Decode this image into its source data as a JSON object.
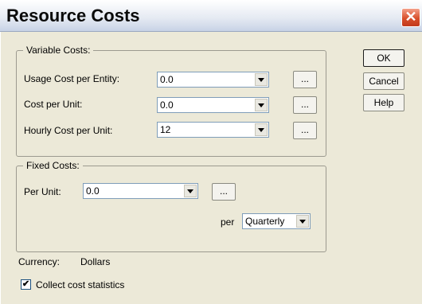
{
  "window": {
    "title": "Resource Costs",
    "close_glyph": "✕"
  },
  "variable_costs": {
    "legend": "Variable Costs:",
    "rows": [
      {
        "label": "Usage Cost per Entity:",
        "value": "0.0",
        "button": "..."
      },
      {
        "label": "Cost per Unit:",
        "value": "0.0",
        "button": "..."
      },
      {
        "label": "Hourly Cost per Unit:",
        "value": "12",
        "button": "..."
      }
    ]
  },
  "fixed_costs": {
    "legend": "Fixed Costs:",
    "per_unit_label": "Per Unit:",
    "per_unit_value": "0.0",
    "button": "...",
    "per_label": "per",
    "period_value": "Quarterly"
  },
  "buttons": {
    "ok": "OK",
    "cancel": "Cancel",
    "help": "Help"
  },
  "currency": {
    "label": "Currency:",
    "value": "Dollars"
  },
  "collect_stats": {
    "label": "Collect cost statistics",
    "checked": true,
    "check_glyph": "✔"
  },
  "icons": {
    "close": "close-icon",
    "dropdown": "chevron-down-icon",
    "checkbox": "checkmark-icon"
  },
  "colors": {
    "close_button": "#d8502c",
    "field_border": "#7f9db9",
    "background": "#ece9d8"
  }
}
